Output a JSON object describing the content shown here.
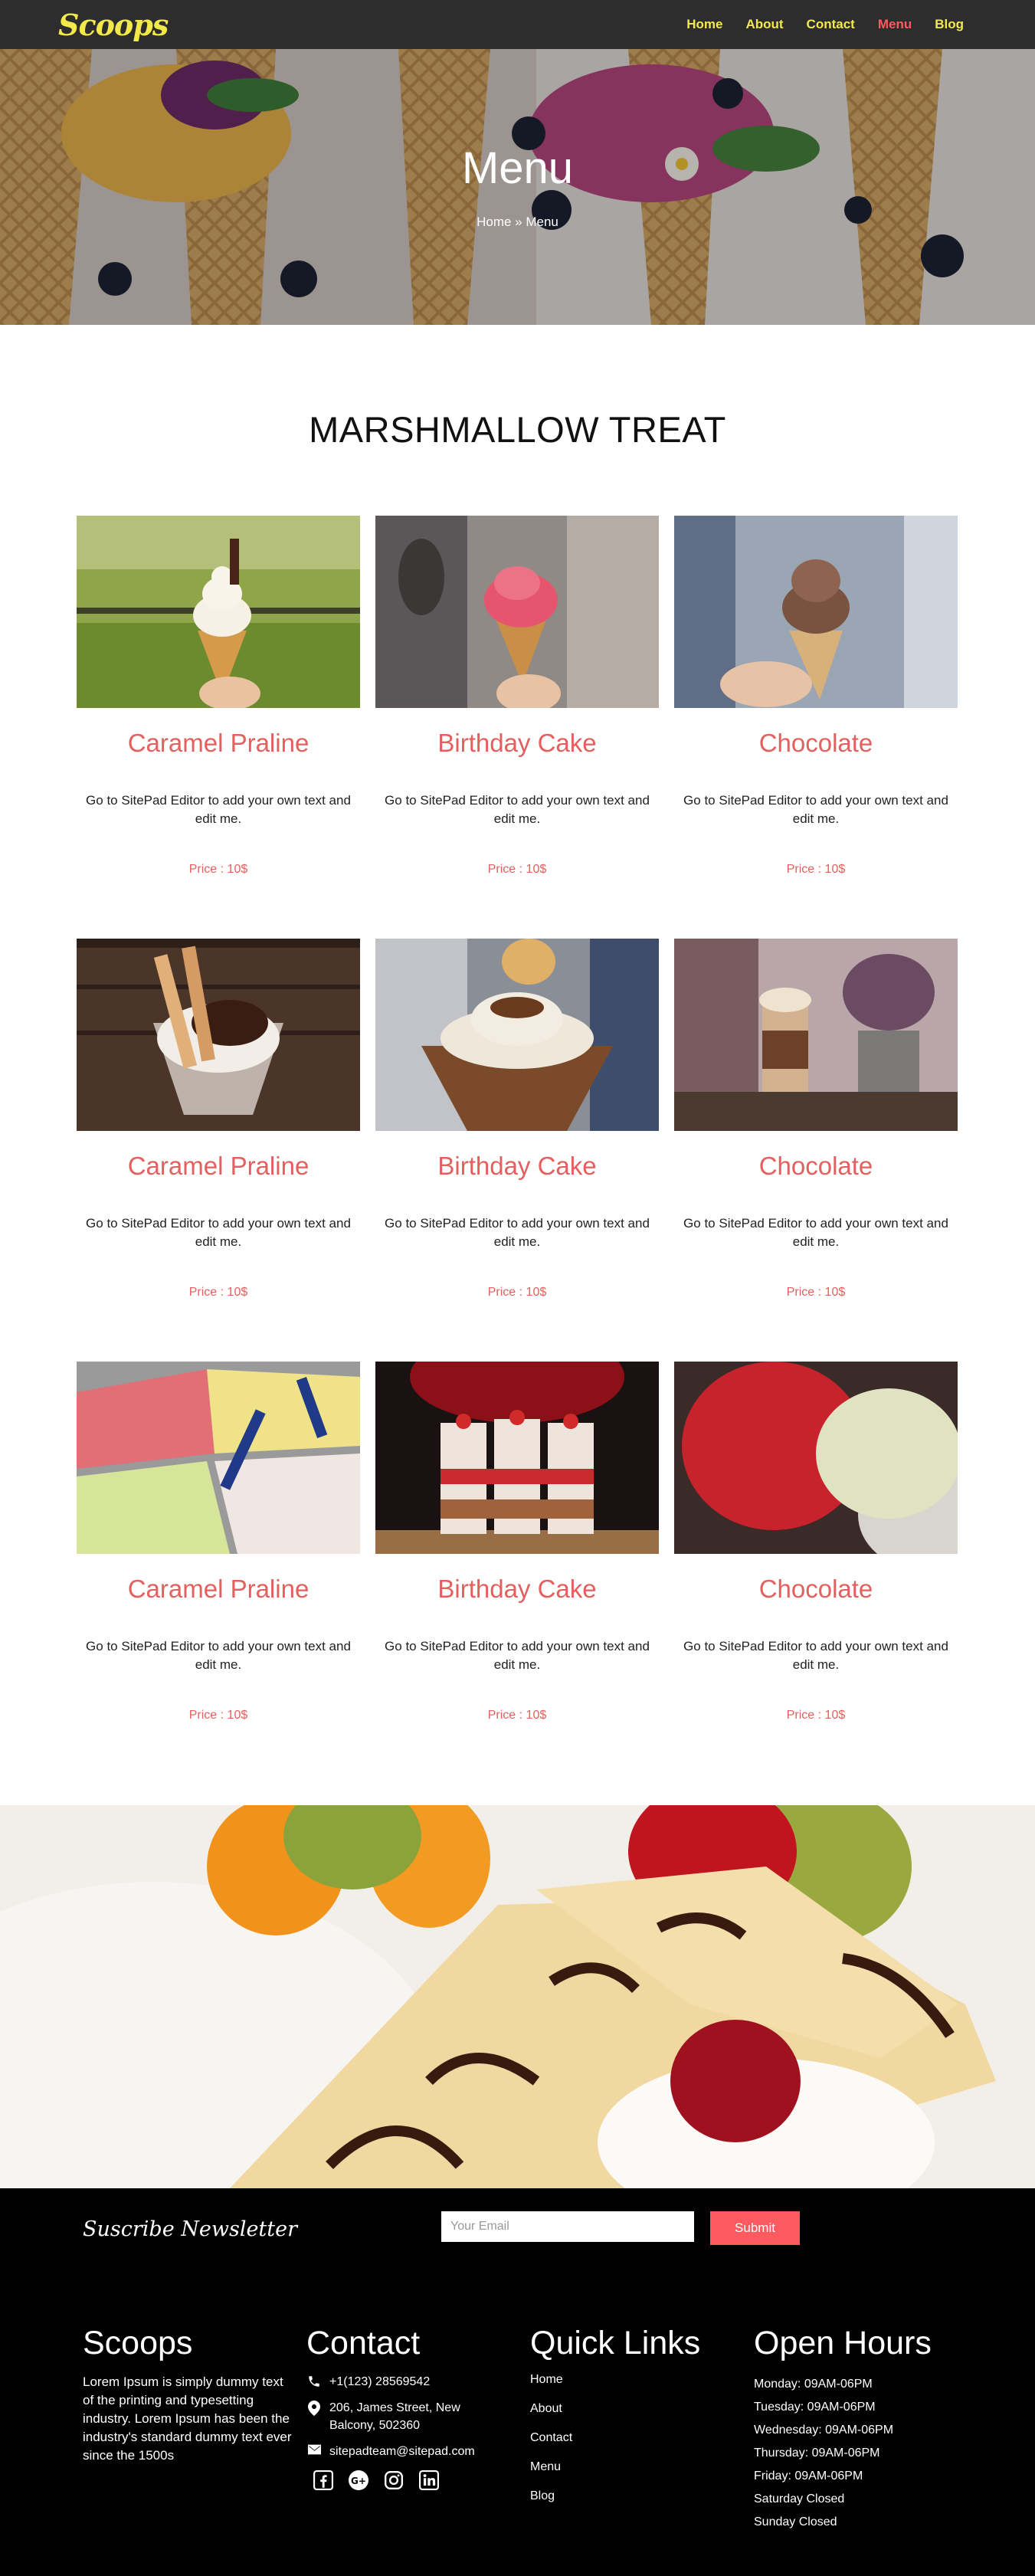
{
  "brand": {
    "logo": "Scoops",
    "logo_color": "#f3e94b"
  },
  "nav": {
    "items": [
      {
        "label": "Home",
        "active": false
      },
      {
        "label": "About",
        "active": false
      },
      {
        "label": "Contact",
        "active": false
      },
      {
        "label": "Menu",
        "active": true
      },
      {
        "label": "Blog",
        "active": false
      }
    ],
    "active_color": "#ff5a5f"
  },
  "hero": {
    "title": "Menu",
    "breadcrumb": "Home » Menu"
  },
  "section": {
    "title": "MARSHMALLOW TREAT"
  },
  "products": [
    {
      "name": "Caramel Praline",
      "desc": "Go to SitePad Editor to add your own text and edit me.",
      "price": "Price : 10$",
      "image": "soft-serve-cone-on-grass"
    },
    {
      "name": "Birthday Cake",
      "desc": "Go to SitePad Editor to add your own text and edit me.",
      "price": "Price : 10$",
      "image": "pink-scoop-cone"
    },
    {
      "name": "Chocolate",
      "desc": "Go to SitePad Editor to add your own text and edit me.",
      "price": "Price : 10$",
      "image": "chocolate-scoop-cone"
    },
    {
      "name": "Caramel Praline",
      "desc": "Go to SitePad Editor to add your own text and edit me.",
      "price": "Price : 10$",
      "image": "sundae-with-wafer-rolls"
    },
    {
      "name": "Birthday Cake",
      "desc": "Go to SitePad Editor to add your own text and edit me.",
      "price": "Price : 10$",
      "image": "nut-sundae-with-cookie"
    },
    {
      "name": "Chocolate",
      "desc": "Go to SitePad Editor to add your own text and edit me.",
      "price": "Price : 10$",
      "image": "iced-coffee-glass"
    },
    {
      "name": "Caramel Praline",
      "desc": "Go to SitePad Editor to add your own text and edit me.",
      "price": "Price : 10$",
      "image": "gelato-display-case"
    },
    {
      "name": "Birthday Cake",
      "desc": "Go to SitePad Editor to add your own text and edit me.",
      "price": "Price : 10$",
      "image": "strawberry-parfait-glasses"
    },
    {
      "name": "Chocolate",
      "desc": "Go to SitePad Editor to add your own text and edit me.",
      "price": "Price : 10$",
      "image": "red-and-green-scoops"
    }
  ],
  "accent_color": "#e3605e",
  "newsletter": {
    "title": "Suscribe Newsletter",
    "placeholder": "Your Email",
    "button": "Submit"
  },
  "footer": {
    "about": {
      "title": "Scoops",
      "text": "Lorem Ipsum is simply dummy text of the printing and typesetting industry. Lorem Ipsum has been the industry's standard dummy text ever since the 1500s"
    },
    "contact": {
      "title": "Contact",
      "phone": "+1(123) 28569542",
      "address": "206, James Street, New Balcony, 502360",
      "email": "sitepadteam@sitepad.com",
      "social": [
        "facebook-icon",
        "google-plus-icon",
        "instagram-icon",
        "linkedin-icon"
      ]
    },
    "links": {
      "title": "Quick Links",
      "items": [
        "Home",
        "About",
        "Contact",
        "Menu",
        "Blog"
      ]
    },
    "hours": {
      "title": "Open Hours",
      "items": [
        "Monday: 09AM-06PM",
        "Tuesday: 09AM-06PM",
        "Wednesday: 09AM-06PM",
        "Thursday: 09AM-06PM",
        "Friday: 09AM-06PM",
        "Saturday Closed",
        "Sunday Closed"
      ]
    }
  }
}
